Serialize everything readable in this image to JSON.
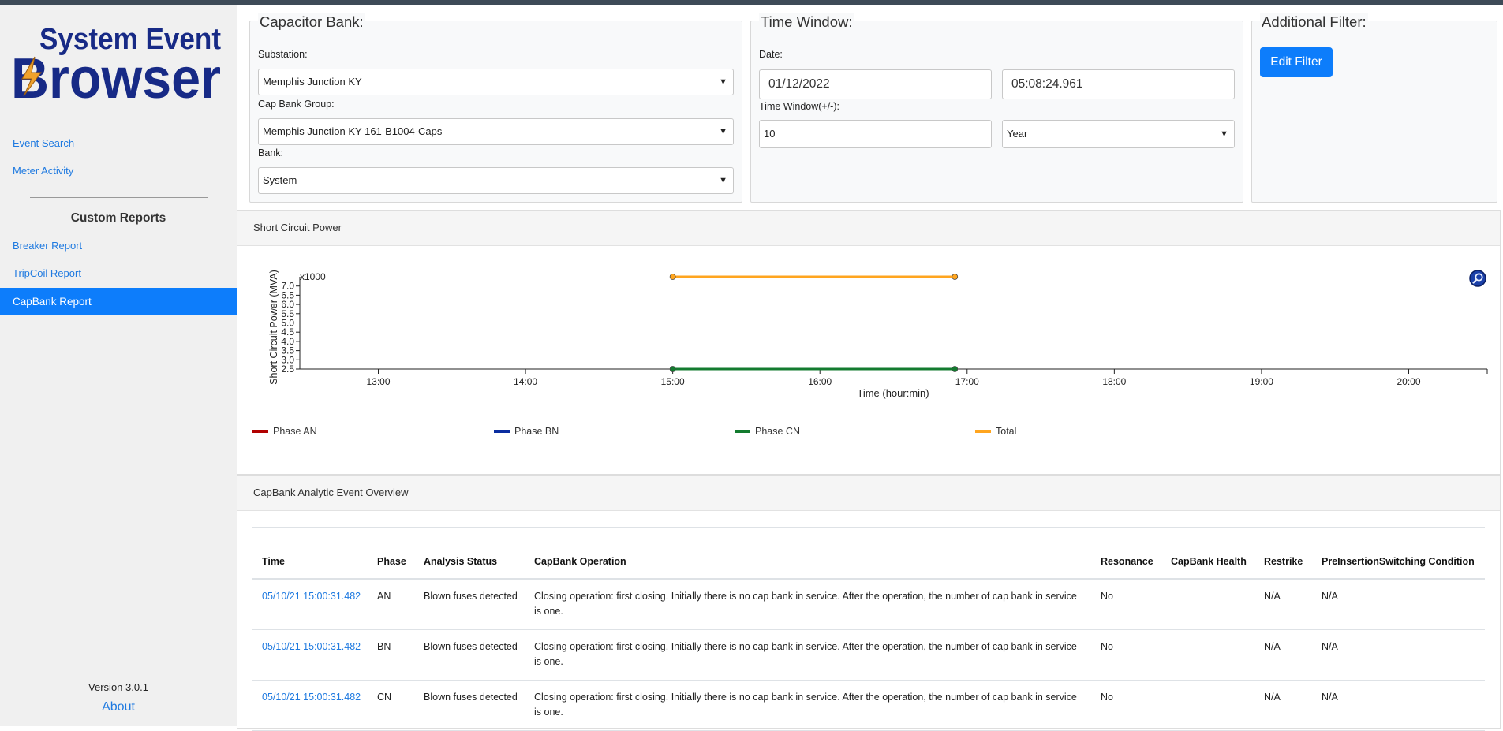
{
  "app": {
    "logo_line1": "System Event",
    "logo_line2": "Browser",
    "version": "Version 3.0.1",
    "about": "About"
  },
  "nav": {
    "event_search": "Event Search",
    "meter_activity": "Meter Activity",
    "custom_reports_heading": "Custom Reports",
    "breaker_report": "Breaker Report",
    "tripcoil_report": "TripCoil Report",
    "capbank_report": "CapBank Report"
  },
  "capacitor_bank": {
    "legend": "Capacitor Bank:",
    "substation_label": "Substation:",
    "substation_value": "Memphis Junction KY",
    "group_label": "Cap Bank Group:",
    "group_value": "Memphis Junction KY 161-B1004-Caps",
    "bank_label": "Bank:",
    "bank_value": "System"
  },
  "time_window": {
    "legend": "Time Window:",
    "date_label": "Date:",
    "date_value": "01/12/2022",
    "time_value": "05:08:24.961",
    "window_label": "Time Window(+/-):",
    "window_value": "10",
    "unit_value": "Year"
  },
  "additional_filter": {
    "legend": "Additional Filter:",
    "edit_button": "Edit Filter"
  },
  "chart_panel": {
    "header": "Short Circuit Power"
  },
  "chart_data": {
    "type": "line",
    "title": "",
    "xlabel": "Time (hour:min)",
    "ylabel": "Short Circuit Power (MVA)",
    "y_multiplier_label": "x1000",
    "x_ticks": [
      "13:00",
      "14:00",
      "15:00",
      "16:00",
      "17:00",
      "18:00",
      "19:00",
      "20:00"
    ],
    "y_ticks": [
      "2.5",
      "3.0",
      "3.5",
      "4.0",
      "4.5",
      "5.0",
      "5.5",
      "6.0",
      "6.5",
      "7.0"
    ],
    "xlim": [
      "12:28",
      "20:32"
    ],
    "ylim": [
      2.5,
      7.5
    ],
    "series": [
      {
        "name": "Phase AN",
        "color": "#b10000",
        "x": [],
        "y": []
      },
      {
        "name": "Phase BN",
        "color": "#0a2da0",
        "x": [],
        "y": []
      },
      {
        "name": "Phase CN",
        "color": "#137b2f",
        "x": [
          "15:00",
          "16:55"
        ],
        "y": [
          2.5,
          2.5
        ]
      },
      {
        "name": "Total",
        "color": "#ffa51f",
        "x": [
          "15:00",
          "16:55"
        ],
        "y": [
          7.5,
          7.5
        ]
      }
    ],
    "legend_position": "bottom"
  },
  "table_panel": {
    "header": "CapBank Analytic Event Overview",
    "columns": [
      "Time",
      "Phase",
      "Analysis Status",
      "CapBank Operation",
      "Resonance",
      "CapBank Health",
      "Restrike",
      "PreInsertionSwitching Condition"
    ],
    "rows": [
      {
        "time": "05/10/21 15:00:31.482",
        "phase": "AN",
        "status": "Blown fuses detected",
        "operation": "Closing operation: first closing. Initially there is no cap bank in service. After the operation, the number of cap bank in service is one.",
        "resonance": "No",
        "health": "",
        "restrike": "N/A",
        "preinsertion": "N/A"
      },
      {
        "time": "05/10/21 15:00:31.482",
        "phase": "BN",
        "status": "Blown fuses detected",
        "operation": "Closing operation: first closing. Initially there is no cap bank in service. After the operation, the number of cap bank in service is one.",
        "resonance": "No",
        "health": "",
        "restrike": "N/A",
        "preinsertion": "N/A"
      },
      {
        "time": "05/10/21 15:00:31.482",
        "phase": "CN",
        "status": "Blown fuses detected",
        "operation": "Closing operation: first closing. Initially there is no cap bank in service. After the operation, the number of cap bank in service is one.",
        "resonance": "No",
        "health": "",
        "restrike": "N/A",
        "preinsertion": "N/A"
      }
    ]
  }
}
